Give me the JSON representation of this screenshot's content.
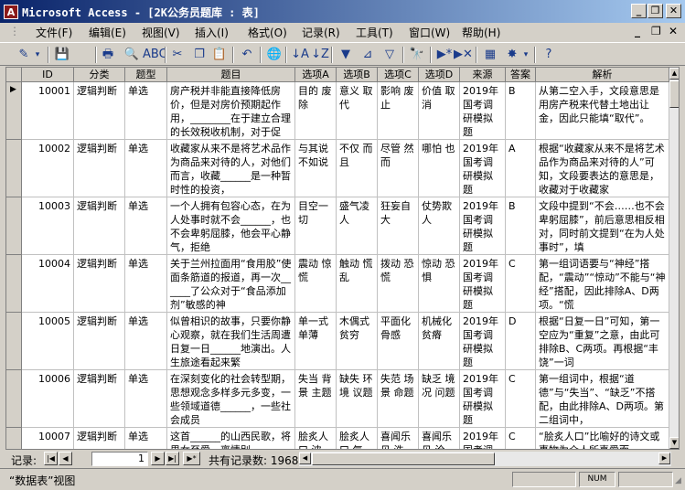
{
  "window": {
    "title": "Microsoft Access - [2K公务员题库 : 表]",
    "app_icon": "A",
    "controls": {
      "minimize": "_",
      "restore": "❐",
      "close": "✕"
    },
    "mdi_controls": {
      "minimize": "_",
      "restore": "❐",
      "close": "✕"
    }
  },
  "menu": [
    "文件(F)",
    "编辑(E)",
    "视图(V)",
    "插入(I)",
    "格式(O)",
    "记录(R)",
    "工具(T)",
    "窗口(W)",
    "帮助(H)"
  ],
  "toolbar": {
    "icons": [
      "design-view-icon",
      "dropdown-arrow-icon",
      "save-icon",
      "print-icon",
      "print-preview-icon",
      "spelling-icon",
      "cut-icon",
      "copy-icon",
      "paste-icon",
      "undo-icon",
      "hyperlink-icon",
      "sort-ascending-icon",
      "sort-descending-icon",
      "filter-by-selection-icon",
      "filter-by-form-icon",
      "apply-filter-icon",
      "find-icon",
      "new-record-icon",
      "delete-record-icon",
      "database-window-icon",
      "new-object-icon",
      "dropdown-arrow-icon",
      "help-icon"
    ],
    "glyphs": [
      "✎",
      "▾",
      "💾",
      "🖶",
      "🔍",
      "ABC",
      "✂",
      "❐",
      "📋",
      "↶",
      "🌐",
      "↓A",
      "↓Z",
      "▼",
      "⊿",
      "▽",
      "🔭",
      "▶*",
      "▶✕",
      "▦",
      "✸",
      "▾",
      "?"
    ]
  },
  "table": {
    "columns": [
      "ID",
      "分类",
      "题型",
      "题目",
      "选项A",
      "选项B",
      "选项C",
      "选项D",
      "来源",
      "答案",
      "解析"
    ],
    "current_row_marker": "▶",
    "rows": [
      [
        "10001",
        "逻辑判断",
        "单选",
        "房产税并非能直接降低房价，但是对房价预期起作用，________在于建立合理的长效税收机制，对于促",
        "目的 废除",
        "意义 取代",
        "影响 废止",
        "价值 取消",
        "2019年国考调研模拟题",
        "B",
        "从第二空入手，文段意思是用房产税来代替土地出让金，因此只能填“取代”。"
      ],
      [
        "10002",
        "逻辑判断",
        "单选",
        "收藏家从来不是将艺术品作为商品来对待的人，对他们而言，收藏______是一种暂时性的投资，",
        "与其说 不如说",
        "不仅 而且",
        "尽管 然而",
        "哪怕 也",
        "2019年国考调研模拟题",
        "A",
        "根据“收藏家从来不是将艺术品作为商品来对待的人”可知，文段要表达的意思是，收藏对于收藏家"
      ],
      [
        "10003",
        "逻辑判断",
        "单选",
        "一个人拥有包容心态，在为人处事时就不会______，也不会卑躬屈膝，他会平心静气，拒绝",
        "目空一切",
        "盛气凌人",
        "狂妄自大",
        "仗势欺人",
        "2019年国考调研模拟题",
        "B",
        "文段中提到“不会……也不会卑躬屈膝”，前后意思相反相对，同时前文提到“在为人处事时”，填"
      ],
      [
        "10004",
        "逻辑判断",
        "单选",
        "关于兰州拉面用“食用胶”使面条筋道的报道，再一次______了公众对于“食品添加剂”敏感的神",
        "震动 惊慌",
        "触动 慌乱",
        "拨动 恐慌",
        "惊动 恐惧",
        "2019年国考调研模拟题",
        "C",
        "第一组词语要与“神经”搭配，“震动”“惊动”不能与“神经”搭配，因此排除A、D两项。“慌"
      ],
      [
        "10005",
        "逻辑判断",
        "单选",
        "似曾相识的故事，只要你静心观察，就在我们生活周遭日复一日______地演出。人生旅途看起来繁",
        "单一式 单薄",
        "木偶式 贫穷",
        "平面化 骨感",
        "机械化 贫瘠",
        "2019年国考调研模拟题",
        "D",
        "根据“日复一日”可知，第一空应为“重复”之意，由此可排除B、C两项。再根据“丰饶”一词"
      ],
      [
        "10006",
        "逻辑判断",
        "单选",
        "在深刻变化的社会转型期，思想观念多样多元多变，一些领域道德______，一些社会成员",
        "失当 背景 主题",
        "缺失 环境 议题",
        "失范 场景 命题",
        "缺乏 境况 问题",
        "2019年国考调研模拟题",
        "C",
        "第一组词中，根据“道德”与“失当”、“缺乏”不搭配，由此排除A、D两项。第二组词中，"
      ],
      [
        "10007",
        "逻辑判断",
        "单选",
        "这首______的山西民歌，将男女至爱、离情别",
        "脍炙人口 波",
        "脍炙人口 气",
        "喜闻乐见 浩",
        "喜闻乐见 沧",
        "2019年国考调研模拟题",
        "C",
        "“脍炙人口”比喻好的诗文或事物为众人所喜爱而"
      ]
    ]
  },
  "navigation": {
    "record_label": "记录:",
    "current_record": "1",
    "total_text": "共有记录数: 1968",
    "buttons": {
      "first": "|◀",
      "prev": "◀",
      "next": "▶",
      "last": "▶|",
      "new": "▶*"
    }
  },
  "status": {
    "view_text": "“数据表”视图",
    "num_indicator": "NUM"
  }
}
